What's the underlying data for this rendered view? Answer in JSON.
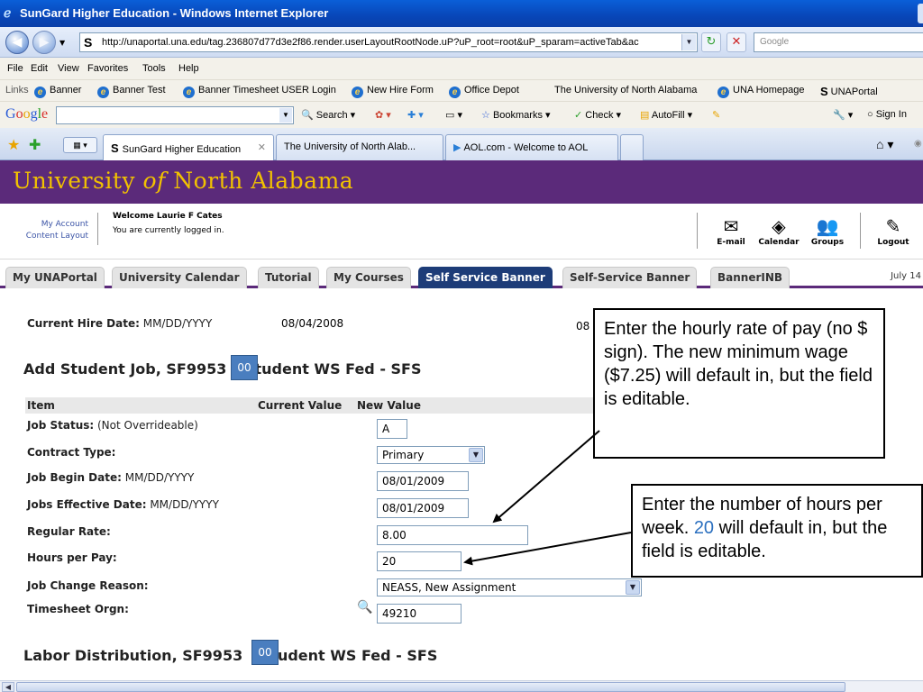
{
  "window": {
    "title": "SunGard Higher Education - Windows Internet Explorer"
  },
  "address": {
    "url": "http://unaportal.una.edu/tag.236807d77d3e2f86.render.userLayoutRootNode.uP?uP_root=root&uP_sparam=activeTab&ac",
    "search_placeholder": "Google"
  },
  "menu": [
    "File",
    "Edit",
    "View",
    "Favorites",
    "Tools",
    "Help"
  ],
  "links_bar": {
    "label": "Links",
    "items": [
      "Banner",
      "Banner Test",
      "Banner Timesheet USER Login",
      "New Hire Form",
      "Office Depot",
      "The University of North Alabama",
      "UNA Homepage",
      "UNAPortal"
    ]
  },
  "google_toolbar": {
    "logo": "Google",
    "search_label": "Search",
    "bookmarks_label": "Bookmarks",
    "check_label": "Check",
    "autofill_label": "AutoFill",
    "signin_label": "Sign In"
  },
  "browser_tabs": [
    "SunGard Higher Education",
    "The University of North Alab...",
    "AOL.com - Welcome to AOL"
  ],
  "portal": {
    "title_pre": "University ",
    "title_of": "of",
    "title_post": " North Alabama",
    "my_account": "My Account",
    "content_layout": "Content Layout",
    "welcome": "Welcome Laurie F Cates",
    "logged_in": "You are currently logged in.",
    "icons": {
      "email": "E-mail",
      "calendar": "Calendar",
      "groups": "Groups",
      "logout": "Logout"
    },
    "tabs": [
      "My UNAPortal",
      "University Calendar",
      "Tutorial",
      "My Courses",
      "Self Service Banner",
      "Self-Service Banner",
      "BannerINB"
    ],
    "active_tab": "Self Service Banner",
    "date": "July 14"
  },
  "form": {
    "hire_date_label": "Current Hire Date:",
    "hire_date_format": " MM/DD/YYYY",
    "hire_date_value": "08/04/2008",
    "hire_date_right_fragment": "08",
    "section1_pre": "Add Student Job, SF9953",
    "section1_post": " Student WS Fed - SFS",
    "badge": "00",
    "col_item": "Item",
    "col_current": "Current Value",
    "col_new": "New Value",
    "rows": {
      "job_status": {
        "label": "Job Status:",
        "note": " (Not Overrideable)",
        "value": "A"
      },
      "contract_type": {
        "label": "Contract Type:",
        "value": "Primary"
      },
      "job_begin": {
        "label": "Job Begin Date:",
        "note": " MM/DD/YYYY",
        "value": "08/01/2009"
      },
      "jobs_effective": {
        "label": "Jobs Effective Date:",
        "note": " MM/DD/YYYY",
        "value": "08/01/2009"
      },
      "regular_rate": {
        "label": "Regular Rate:",
        "value": "8.00"
      },
      "hours_per_pay": {
        "label": "Hours per Pay:",
        "value": "20"
      },
      "job_change_reason": {
        "label": "Job Change Reason:",
        "value": "NEASS, New Assignment"
      },
      "timesheet_orgn": {
        "label": "Timesheet Orgn:",
        "value": "49210"
      }
    },
    "section2_pre": "Labor Distribution, SF9953",
    "section2_post": " Student WS Fed - SFS"
  },
  "callouts": {
    "rate": "Enter the hourly rate of pay (no $ sign).  The new minimum wage ($7.25) will default in, but the field is editable.",
    "hours_pre": "Enter the number of hours per week.  ",
    "hours_num": "20",
    "hours_post": " will default in, but the field is editable."
  }
}
